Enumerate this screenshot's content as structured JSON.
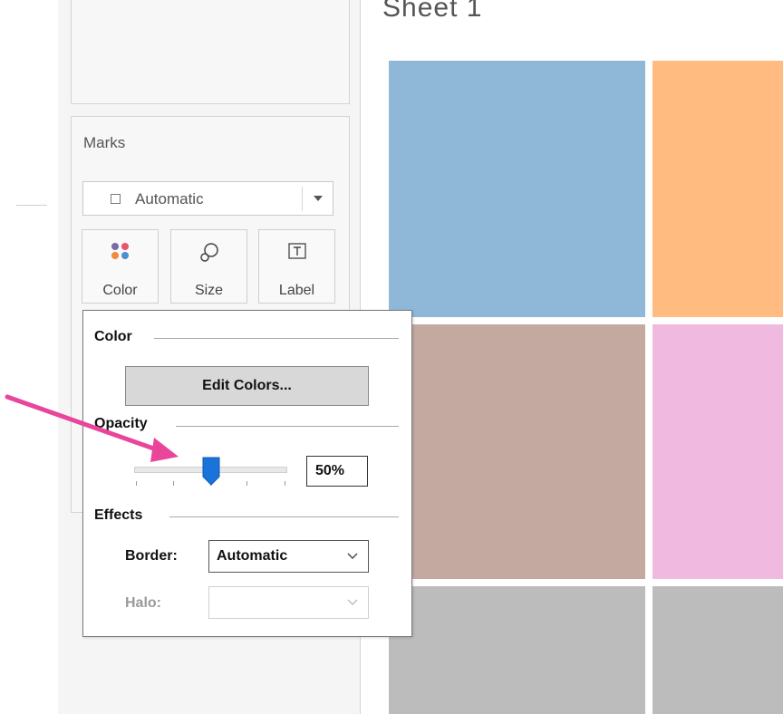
{
  "sheet": {
    "title": "Sheet 1",
    "tiles": [
      {
        "color": "#8fb8d8"
      },
      {
        "color": "#ffbb80"
      },
      {
        "color": "#c4a9a1"
      },
      {
        "color": "#f0b9e0"
      },
      {
        "color": "#bcbcbc"
      },
      {
        "color": "#bcbcbc"
      }
    ]
  },
  "marks": {
    "title": "Marks",
    "mark_type": "Automatic",
    "buttons": [
      {
        "label": "Color",
        "icon": "color-dots-icon"
      },
      {
        "label": "Size",
        "icon": "size-icon"
      },
      {
        "label": "Label",
        "icon": "label-text-icon"
      }
    ]
  },
  "color_popup": {
    "color_heading": "Color",
    "edit_colors_label": "Edit Colors...",
    "opacity_heading": "Opacity",
    "opacity_value": "50%",
    "opacity_fraction": 0.5,
    "effects_heading": "Effects",
    "border_label": "Border:",
    "border_value": "Automatic",
    "halo_label": "Halo:",
    "halo_value": ""
  },
  "annotation": {
    "color": "#e8459b"
  }
}
